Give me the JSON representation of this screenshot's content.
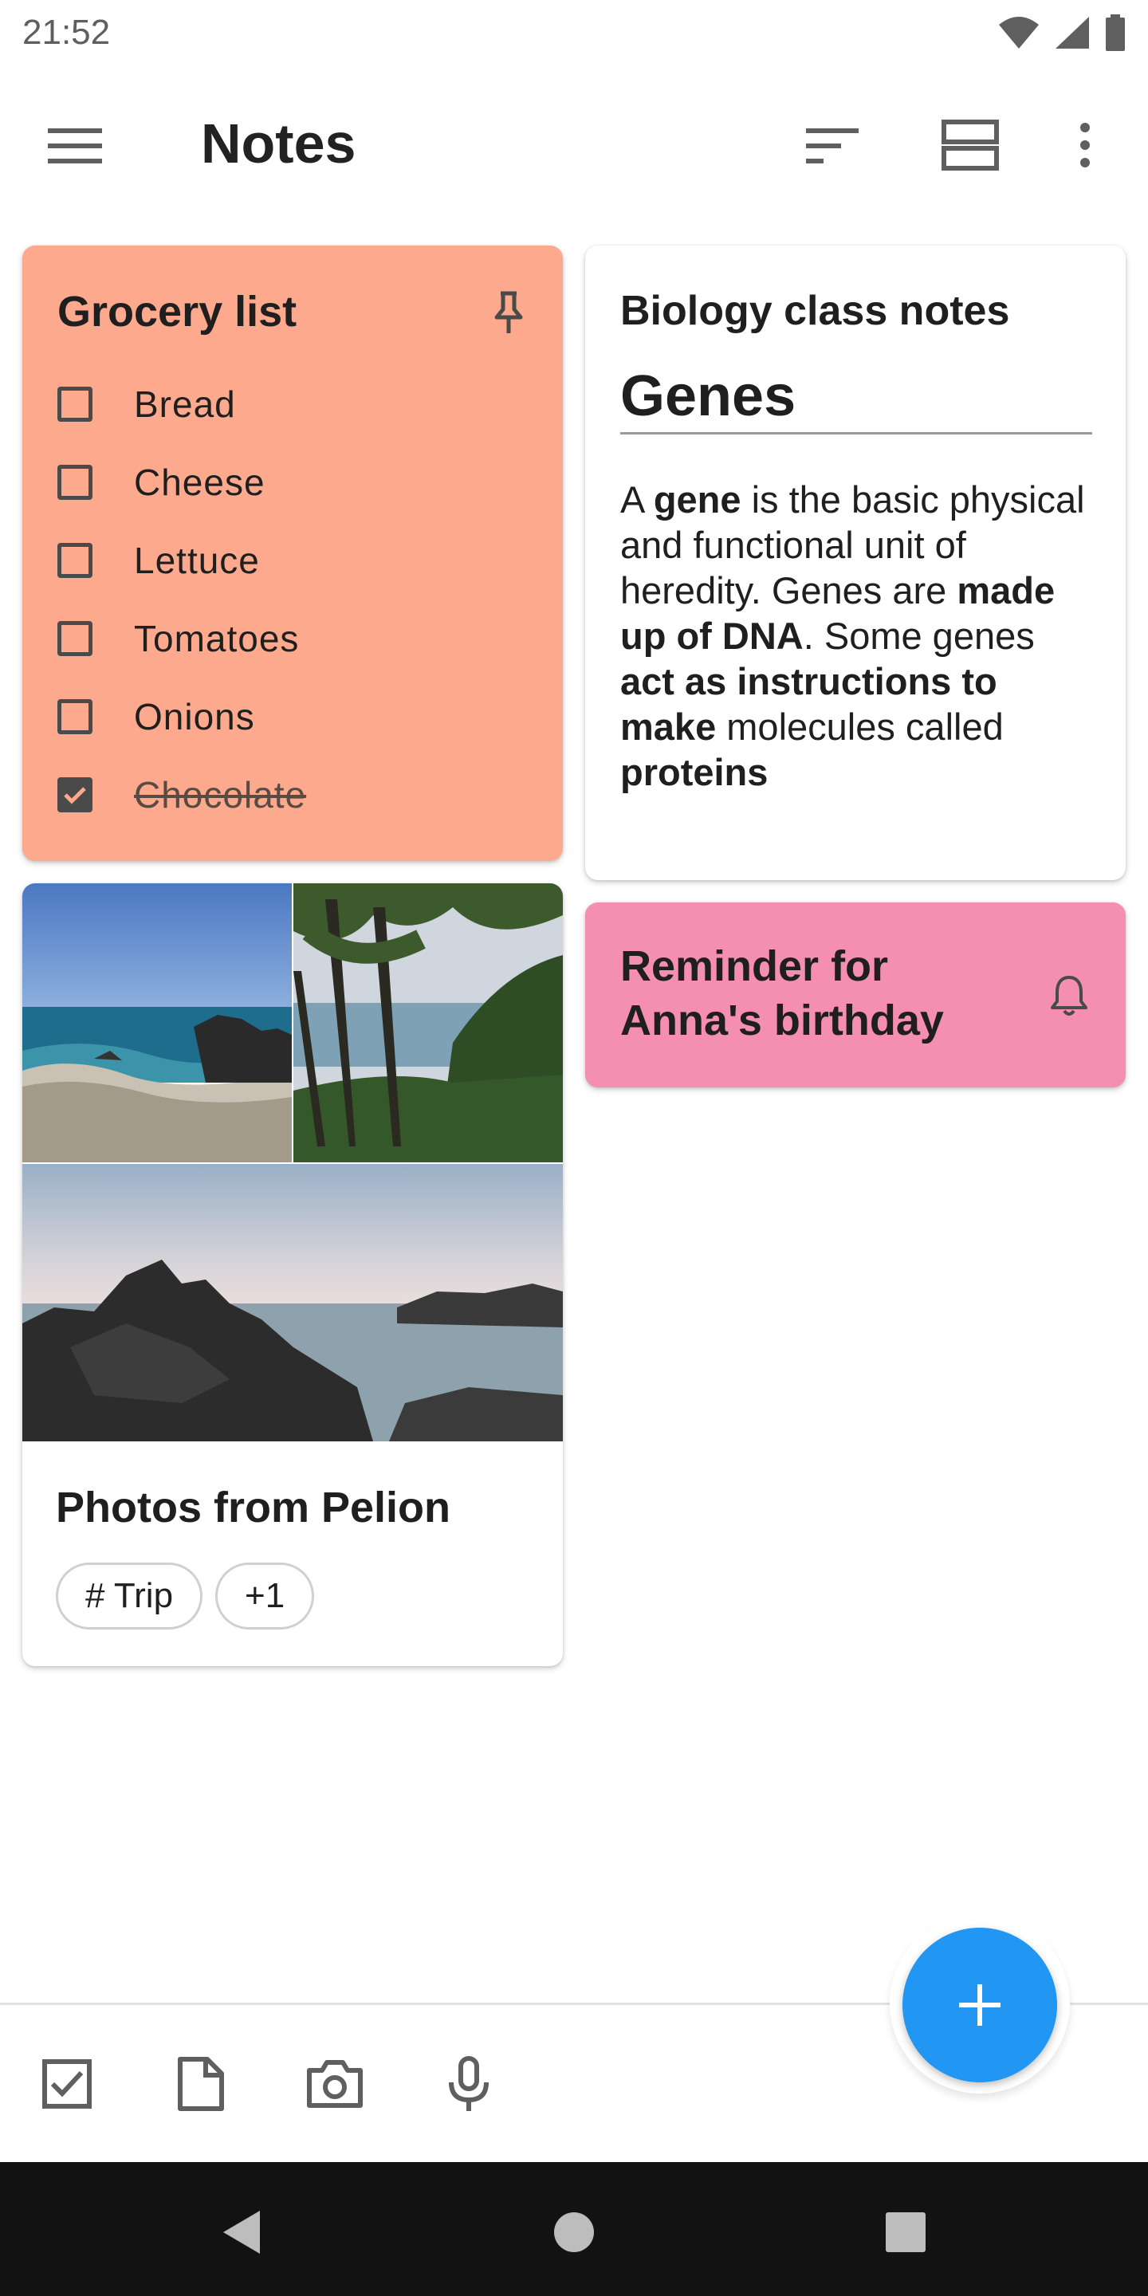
{
  "status_bar": {
    "time": "21:52",
    "icons": [
      "wifi-icon",
      "signal-icon",
      "battery-icon"
    ]
  },
  "app_bar": {
    "title": "Notes",
    "icons": [
      "menu-icon",
      "sort-icon",
      "view-layout-icon",
      "more-vert-icon"
    ]
  },
  "notes": {
    "grocery": {
      "title": "Grocery list",
      "color": "#fca98d",
      "pinned": true,
      "items": [
        {
          "label": "Bread",
          "checked": false
        },
        {
          "label": "Cheese",
          "checked": false
        },
        {
          "label": "Lettuce",
          "checked": false
        },
        {
          "label": "Tomatoes",
          "checked": false
        },
        {
          "label": "Onions",
          "checked": false
        },
        {
          "label": "Chocolate",
          "checked": true
        }
      ]
    },
    "biology": {
      "title": "Biology class notes",
      "heading": "Genes",
      "color": "#ffffff",
      "body": [
        {
          "text": "A ",
          "bold": false
        },
        {
          "text": "gene",
          "bold": true
        },
        {
          "text": " is the basic physical and functional unit of heredity. Genes are ",
          "bold": false
        },
        {
          "text": "made up of DNA",
          "bold": true
        },
        {
          "text": ". Some genes ",
          "bold": false
        },
        {
          "text": "act as instructions to make",
          "bold": true
        },
        {
          "text": " molecules called ",
          "bold": false
        },
        {
          "text": "proteins",
          "bold": true
        }
      ]
    },
    "reminder": {
      "title": "Reminder for Anna's birthday",
      "color": "#f48fb1",
      "icon": "bell-icon"
    },
    "photos": {
      "title": "Photos from Pelion",
      "images": [
        "beach-photo",
        "trees-photo",
        "rocks-photo"
      ],
      "chips": [
        "# Trip",
        "+1"
      ]
    }
  },
  "bottom_bar": {
    "actions": [
      "checkbox-icon",
      "note-icon",
      "camera-icon",
      "mic-icon"
    ],
    "fab_icon": "plus-icon",
    "fab_color": "#2196f3"
  },
  "nav_bar": {
    "buttons": [
      "back-icon",
      "home-icon",
      "recents-icon"
    ]
  }
}
